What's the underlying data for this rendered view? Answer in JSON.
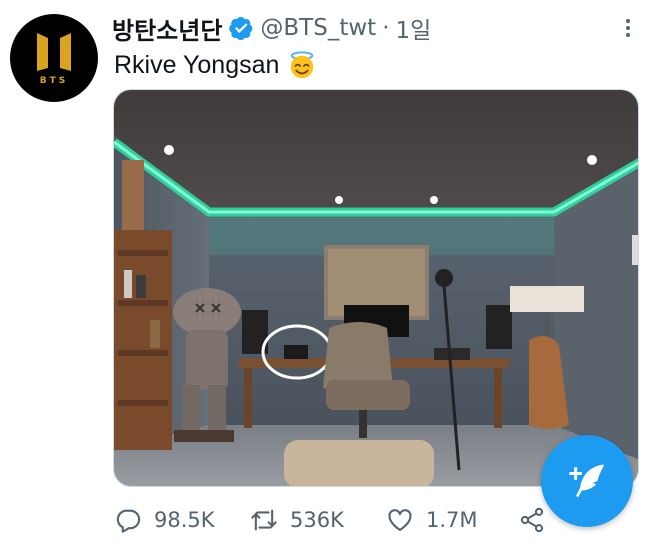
{
  "tweet": {
    "author": {
      "display_name": "방탄소년단",
      "handle": "@BTS_twt",
      "verified": true,
      "avatar_text": "BTS",
      "avatar_accent": "#d9a521"
    },
    "separator": "·",
    "time": "1일",
    "text": "Rkive Yongsan",
    "emoji": "smiling-face-with-halo",
    "stats": {
      "replies": "98.5K",
      "retweets": "536K",
      "likes": "1.7M"
    }
  },
  "colors": {
    "brand": "#1d9bf0",
    "secondary_text": "#536471",
    "primary_text": "#0f1419"
  },
  "icons": {
    "more": "more-horizontal-icon",
    "reply": "reply-icon",
    "retweet": "retweet-icon",
    "like": "heart-icon",
    "share": "share-icon",
    "compose": "compose-feather-icon"
  }
}
